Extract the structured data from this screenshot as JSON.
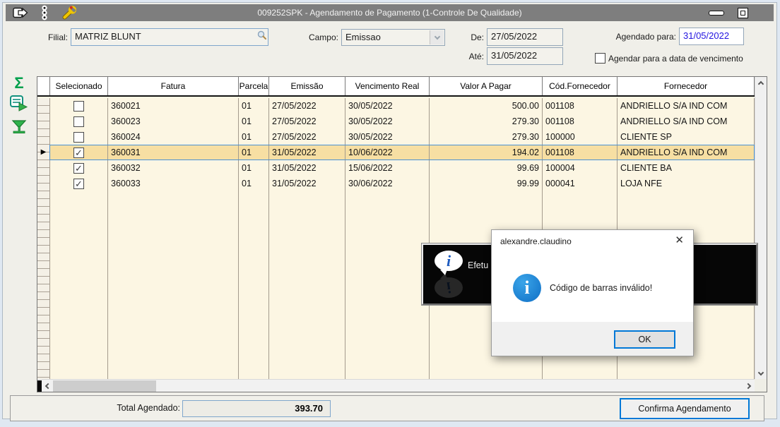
{
  "window": {
    "title": "009252SPK - Agendamento de Pagamento (1-Controle De Qualidade)"
  },
  "filters": {
    "filial_label": "Filial:",
    "filial_value": "MATRIZ BLUNT",
    "campo_label": "Campo:",
    "campo_value": "Emissao",
    "de_label": "De:",
    "de_value": "27/05/2022",
    "ate_label": "Até:",
    "ate_value": "31/05/2022",
    "agendado_label": "Agendado para:",
    "agendado_value": "31/05/2022",
    "vencimento_checkbox_label": "Agendar para a data de vencimento",
    "vencimento_checked": false
  },
  "sidebar": {
    "icons": [
      "sum-sigma-icon",
      "export-grid-icon",
      "filter-funnel-icon"
    ]
  },
  "table": {
    "columns": [
      "Selecionado",
      "Fatura",
      "Parcela",
      "Emissão",
      "Vencimento Real",
      "Valor A Pagar",
      "Cód.Fornecedor",
      "Fornecedor"
    ],
    "rows": [
      {
        "selected": false,
        "current": false,
        "fatura": "360021",
        "parcela": "01",
        "emissao": "27/05/2022",
        "vencimento": "30/05/2022",
        "valor": "500.00",
        "cod": "001108",
        "fornecedor": "ANDRIELLO S/A IND COM"
      },
      {
        "selected": false,
        "current": false,
        "fatura": "360023",
        "parcela": "01",
        "emissao": "27/05/2022",
        "vencimento": "30/05/2022",
        "valor": "279.30",
        "cod": "001108",
        "fornecedor": "ANDRIELLO S/A IND COM"
      },
      {
        "selected": false,
        "current": false,
        "fatura": "360024",
        "parcela": "01",
        "emissao": "27/05/2022",
        "vencimento": "30/05/2022",
        "valor": "279.30",
        "cod": "100000",
        "fornecedor": "CLIENTE SP"
      },
      {
        "selected": true,
        "current": true,
        "fatura": "360031",
        "parcela": "01",
        "emissao": "31/05/2022",
        "vencimento": "10/06/2022",
        "valor": "194.02",
        "cod": "001108",
        "fornecedor": "ANDRIELLO S/A IND COM"
      },
      {
        "selected": true,
        "current": false,
        "fatura": "360032",
        "parcela": "01",
        "emissao": "31/05/2022",
        "vencimento": "15/06/2022",
        "valor": "99.69",
        "cod": "100004",
        "fornecedor": "CLIENTE BA"
      },
      {
        "selected": true,
        "current": false,
        "fatura": "360033",
        "parcela": "01",
        "emissao": "31/05/2022",
        "vencimento": "30/06/2022",
        "valor": "99.99",
        "cod": "000041",
        "fornecedor": "LOJA NFE"
      }
    ]
  },
  "status_overlay": {
    "visible_text": "Efetu"
  },
  "dialog": {
    "title": "alexandre.claudino",
    "message": "Código de barras inválido!",
    "ok_label": "OK",
    "close_glyph": "✕"
  },
  "footer": {
    "total_label": "Total Agendado:",
    "total_value": "393.70",
    "confirm_label": "Confirma Agendamento"
  },
  "colors": {
    "titlebar": "#7e7e7e",
    "row_background": "#fcf6e3",
    "selected_row_background": "#f7dfa3",
    "selected_row_border": "#4a90d2",
    "accent_blue": "#0078d7",
    "date_entry_blue": "#2314e0",
    "sidebar_green": "#00a04c",
    "overlay_background": "#060606"
  }
}
